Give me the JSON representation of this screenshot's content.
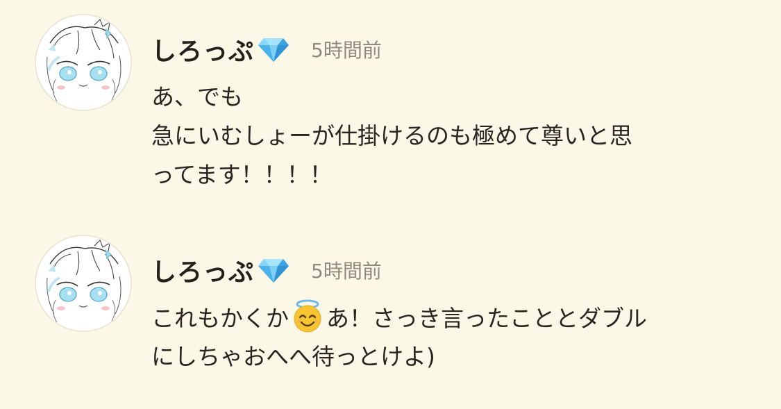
{
  "colors": {
    "background": "#fcf8e7",
    "username": "#24201c",
    "timestamp": "#8f8a80",
    "text": "#2a2520",
    "gem": "#4fb3f0"
  },
  "comments": [
    {
      "avatar_icon": "anime-girl-sketch-avatar",
      "badge_icon": "gem-icon",
      "username": "しろっぷ",
      "timestamp": "5時間前",
      "lines": [
        "あ、でも",
        "急にいむしょーが仕掛けるのも極めて尊いと思",
        "ってます！！！！"
      ]
    },
    {
      "avatar_icon": "anime-girl-sketch-avatar",
      "badge_icon": "gem-icon",
      "username": "しろっぷ",
      "timestamp": "5時間前",
      "line1_before_emoji": "これもかくか",
      "emoji_icon": "smiling-face-with-halo-icon",
      "line1_after_emoji": "あ！さっき言ったこととダブル",
      "line2": "にしちゃおへへ待っとけよ)"
    }
  ]
}
